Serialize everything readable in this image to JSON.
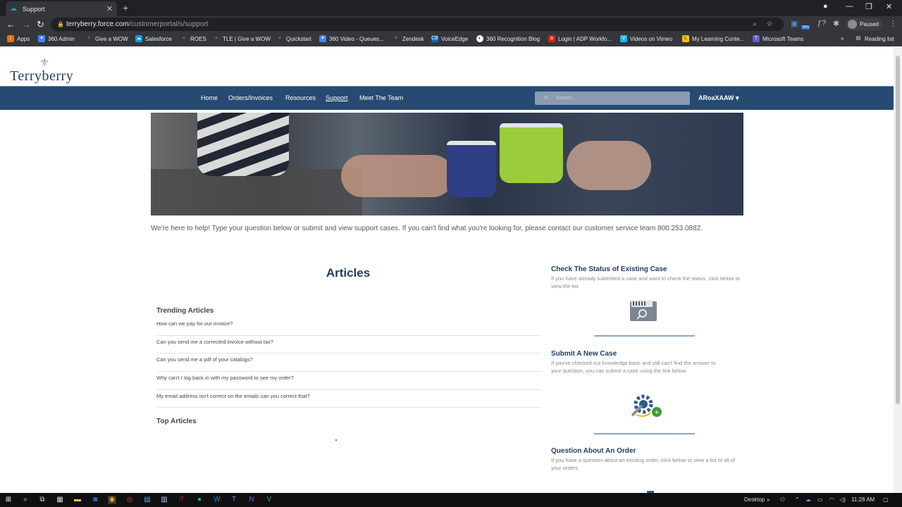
{
  "browser": {
    "tab_title": "Support",
    "url_host": "terryberry.force.com",
    "url_path": "/customerportal/s/support",
    "profile_status": "Paused",
    "badge": "78%",
    "bookmarks": [
      "Apps",
      "360 Admin",
      "Give a WOW",
      "Salesforce",
      "ROES",
      "TLE | Give a WOW",
      "Quickstart",
      "360 Video - Queues...",
      "Zendesk",
      "VoiceEdge",
      "360 Recognition Blog",
      "Login | ADP Workfo...",
      "Videos on Vimeo",
      "My Learning Conte...",
      "Microsoft Teams"
    ],
    "reading_list": "Reading list",
    "more": "»"
  },
  "site": {
    "logo_text": "Terryberry",
    "nav": [
      "Home",
      "Orders/Invoices",
      "Resources",
      "Support",
      "Meet The Team"
    ],
    "search_placeholder": "Search...",
    "user_menu": "ARoaXAAW"
  },
  "intro": "We're here to help! Type your question below or submit and view support cases. If you can't find what you're looking for, please contact our customer service team 800.253.0882.",
  "articles": {
    "title": "Articles",
    "trending_heading": "Trending Articles",
    "trending": [
      "How can we pay for our invoice?",
      "Can you send me a corrected invoice without tax?",
      "Can you send me a pdf of your catalogs?",
      "Why can't I log back in with my password to see my order?",
      "My email address isn't correct on the emails can you correct that?"
    ],
    "top_heading": "Top Articles"
  },
  "side": [
    {
      "title": "Check The Status of Existing Case",
      "desc": "If you have already submitted a case and want to check the status, click below to view the list"
    },
    {
      "title": "Submit A New Case",
      "desc": "If you've checked our knowledge base and still can't find the answer to your question, you can submit a case using the link below"
    },
    {
      "title": "Question About An Order",
      "desc": "If you have a question about an existing order, click below to view a list of all of your orders"
    }
  ],
  "taskbar": {
    "desktop_label": "Desktop",
    "clock": "11:28 AM"
  },
  "colors": {
    "nav_bg": "#274a72",
    "heading": "#1f3a5f",
    "accent_green": "#9bcc3b"
  }
}
